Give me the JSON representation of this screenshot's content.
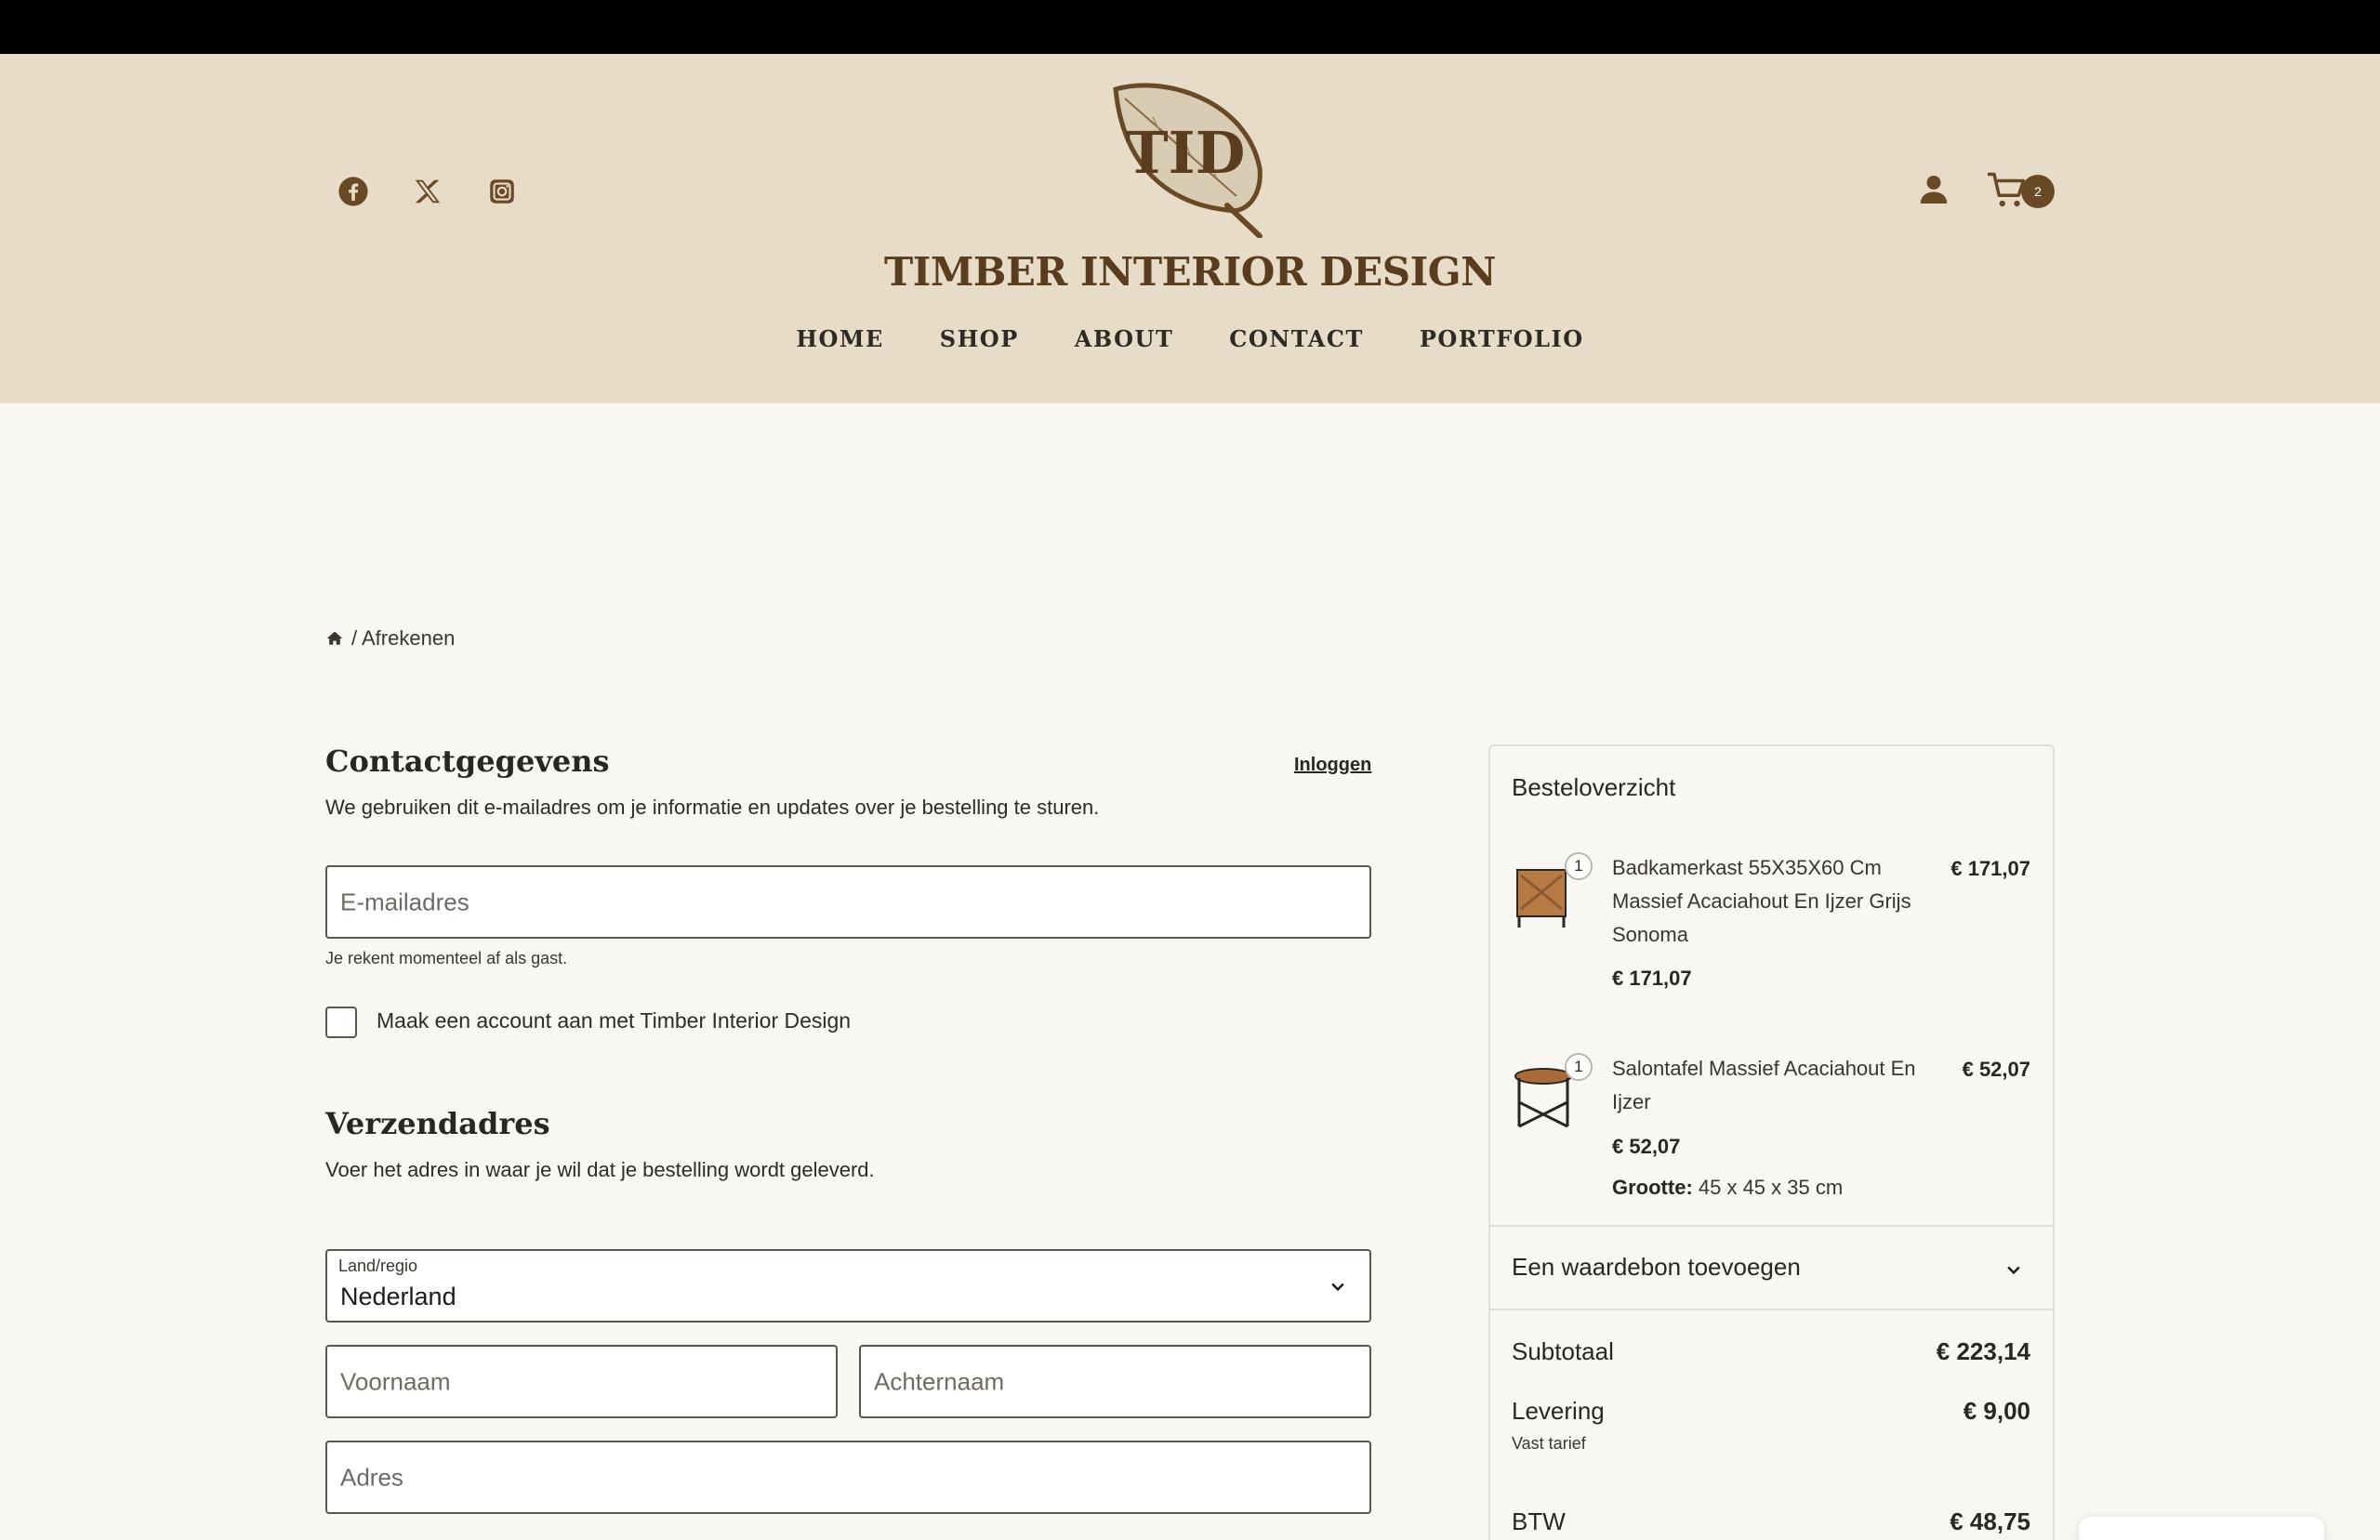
{
  "header": {
    "brand": "TIMBER INTERIOR DESIGN",
    "logo_text": "TID",
    "social": [
      "facebook-icon",
      "x-icon",
      "instagram-icon"
    ],
    "nav": [
      "HOME",
      "SHOP",
      "ABOUT",
      "CONTACT",
      "PORTFOLIO"
    ],
    "cart_count": "2",
    "colors": {
      "header_bg": "#e6dcc8",
      "brand": "#5a3d1e",
      "accent": "#6a4a26"
    }
  },
  "breadcrumb": {
    "current": "/ Afrekenen"
  },
  "contact": {
    "title": "Contactgegevens",
    "login": "Inloggen",
    "description": "We gebruiken dit e-mailadres om je informatie en updates over je bestelling te sturen.",
    "email_placeholder": "E-mailadres",
    "guest_note": "Je rekent momenteel af als gast.",
    "create_account": "Maak een account aan met Timber Interior Design"
  },
  "shipping": {
    "title": "Verzendadres",
    "description": "Voer het adres in waar je wil dat je bestelling wordt geleverd.",
    "country_label": "Land/regio",
    "country_value": "Nederland",
    "first_name": "Voornaam",
    "last_name": "Achternaam",
    "address": "Adres"
  },
  "summary": {
    "title": "Besteloverzicht",
    "items": [
      {
        "qty": "1",
        "name": "Badkamerkast 55X35X60 Cm Massief Acaciahout En Ijzer Grijs Sonoma",
        "line_total": "€ 171,07",
        "unit_price": "€ 171,07"
      },
      {
        "qty": "1",
        "name": "Salontafel Massief Acaciahout En Ijzer",
        "line_total": "€ 52,07",
        "unit_price": "€ 52,07",
        "meta_label": "Grootte:",
        "meta_value": " 45 x 45 x 35 cm"
      }
    ],
    "coupon": "Een waardebon toevoegen",
    "subtotal_label": "Subtotaal",
    "subtotal_value": "€ 223,14",
    "delivery_label": "Levering",
    "delivery_value": "€ 9,00",
    "delivery_note": "Vast tarief",
    "tax_label": "BTW",
    "tax_value": "€ 48,75"
  }
}
